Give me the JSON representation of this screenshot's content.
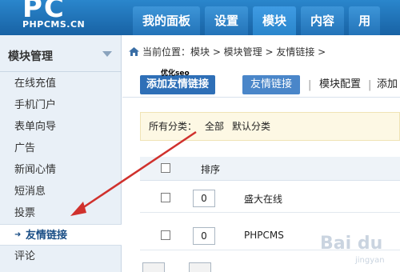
{
  "logo": {
    "letters": "PC",
    "text": "PHPCMS.CN"
  },
  "nav": {
    "tabs": [
      {
        "label": "我的面板"
      },
      {
        "label": "设置"
      },
      {
        "label": "模块",
        "active": true
      },
      {
        "label": "内容"
      },
      {
        "label": "用"
      }
    ]
  },
  "sidebar": {
    "title": "模块管理",
    "items": [
      {
        "label": "在线充值"
      },
      {
        "label": "手机门户"
      },
      {
        "label": "表单向导"
      },
      {
        "label": "广告"
      },
      {
        "label": "新闻心情"
      },
      {
        "label": "短消息"
      },
      {
        "label": "投票"
      },
      {
        "label": "友情链接",
        "active": true
      },
      {
        "label": "评论"
      }
    ]
  },
  "breadcrumb": "当前位置：模块 > 模块管理 > 友情链接 >",
  "toolbar": {
    "add_button": "添加友情链接",
    "tip": "优化seo",
    "links_tab": "友情链接",
    "module_config": "模块配置",
    "more": "添加"
  },
  "filter": {
    "label": "所有分类：",
    "all": "全部",
    "default": "默认分类"
  },
  "table": {
    "header_order": "排序",
    "rows": [
      {
        "order": "0",
        "name": "盛大在线"
      },
      {
        "order": "0",
        "name": "PHPCMS"
      }
    ]
  },
  "watermark": {
    "text": "Bai du",
    "sub": "jingyan"
  },
  "colors": {
    "header": "#1a6cad",
    "accent": "#2e6fb7",
    "arrow": "#d0312d"
  }
}
